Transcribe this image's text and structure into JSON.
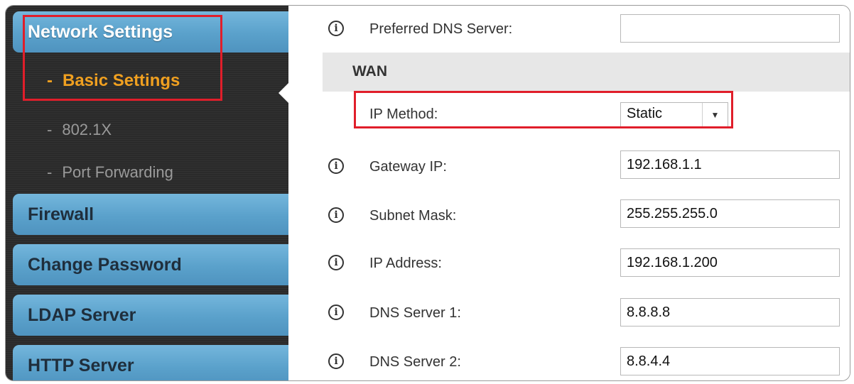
{
  "sidebar": {
    "header": "Network Settings",
    "subitems": [
      {
        "label": "Basic Settings"
      },
      {
        "label": "802.1X"
      },
      {
        "label": "Port Forwarding"
      }
    ],
    "sections": [
      {
        "label": "Firewall"
      },
      {
        "label": "Change Password"
      },
      {
        "label": "LDAP Server"
      },
      {
        "label": "HTTP Server"
      }
    ],
    "dash": "-"
  },
  "form": {
    "preferred_dns": {
      "label": "Preferred DNS Server:",
      "value": ""
    },
    "section_title": "WAN",
    "ip_method": {
      "label": "IP Method:",
      "value": "Static",
      "arrow": "▼"
    },
    "gateway": {
      "label": "Gateway IP:",
      "value": "192.168.1.1"
    },
    "subnet": {
      "label": "Subnet Mask:",
      "value": "255.255.255.0"
    },
    "ip_address": {
      "label": "IP Address:",
      "value": "192.168.1.200"
    },
    "dns1": {
      "label": "DNS Server 1:",
      "value": "8.8.8.8"
    },
    "dns2": {
      "label": "DNS Server 2:",
      "value": "8.8.4.4"
    },
    "info_glyph": "i"
  },
  "colors": {
    "highlight": "#e01e2a",
    "active_item": "#f0a020",
    "nav_blue": "#5aa1cb"
  }
}
